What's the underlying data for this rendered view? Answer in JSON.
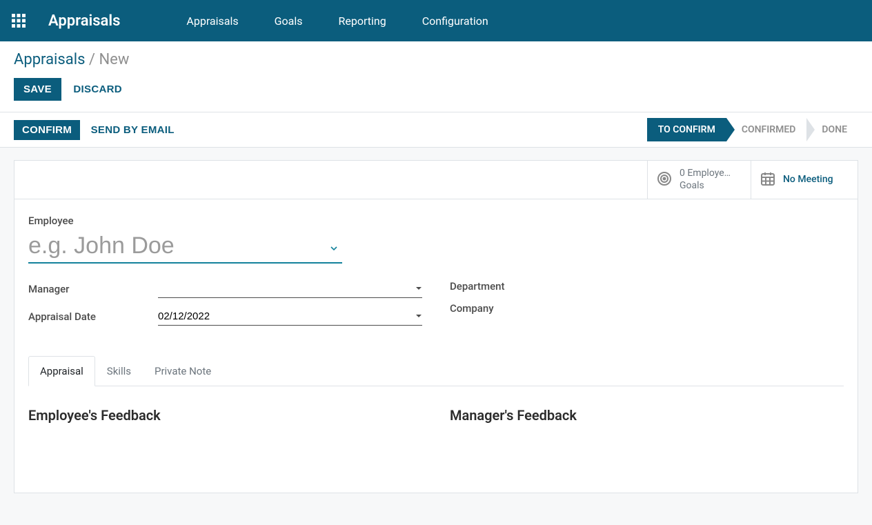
{
  "nav": {
    "brand": "Appraisals",
    "items": [
      "Appraisals",
      "Goals",
      "Reporting",
      "Configuration"
    ]
  },
  "breadcrumb": {
    "parent": "Appraisals",
    "current": "New"
  },
  "buttons": {
    "save": "SAVE",
    "discard": "DISCARD",
    "confirm": "CONFIRM",
    "send_email": "SEND BY EMAIL"
  },
  "status": {
    "steps": [
      "TO CONFIRM",
      "CONFIRMED",
      "DONE"
    ],
    "active": 0
  },
  "stats": {
    "goals": {
      "count": "0",
      "label_line1": "0 Employe…",
      "label_line2": "Goals"
    },
    "meeting": {
      "label": "No Meeting"
    }
  },
  "form": {
    "employee_label": "Employee",
    "employee_placeholder": "e.g. John Doe",
    "manager_label": "Manager",
    "manager_value": "",
    "appraisal_date_label": "Appraisal Date",
    "appraisal_date_value": "02/12/2022",
    "department_label": "Department",
    "company_label": "Company"
  },
  "tabs": {
    "items": [
      "Appraisal",
      "Skills",
      "Private Note"
    ],
    "active": 0
  },
  "feedback": {
    "employee": "Employee's Feedback",
    "manager": "Manager's Feedback"
  }
}
